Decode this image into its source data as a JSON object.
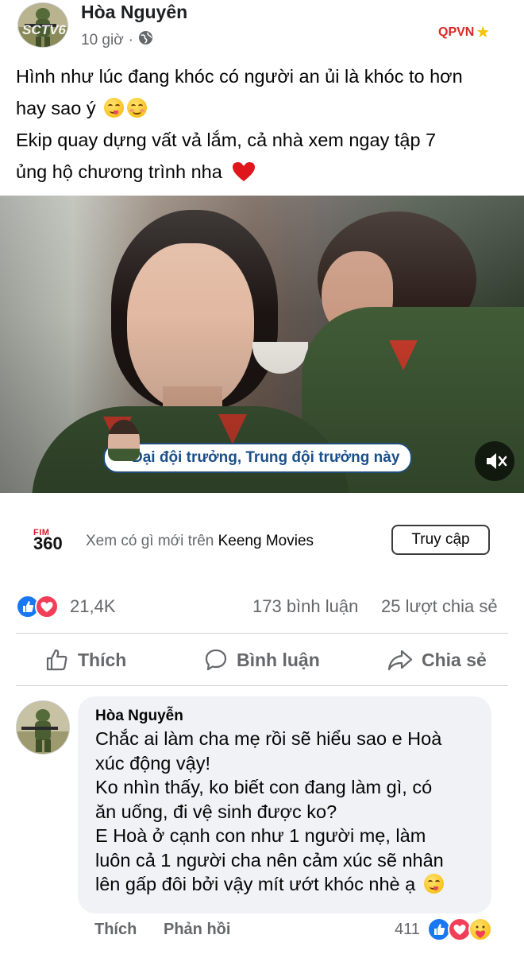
{
  "post": {
    "author": "Hòa Nguyên",
    "time": "10 giờ",
    "separator": "·",
    "privacy_icon": "globe-icon",
    "text_lines": [
      "Hình như lúc đang khóc có người an ủi là khóc to hơn",
      "hay sao ý",
      "Ekip quay dựng vất vả lắm, cả nhà xem ngay tập 7",
      "ủng hộ chương trình nha"
    ]
  },
  "video": {
    "channel_logo_left": "SCTV6",
    "channel_logo_right": "QPVN",
    "caption": "Đại đội trưởng, Trung đội trưởng này",
    "mute_icon": "speaker-muted-icon"
  },
  "ad": {
    "logo_top": "FIM",
    "logo_bottom": "360",
    "text": "Xem có gì mới trên",
    "brand": "Keeng Movies",
    "cta": "Truy cập"
  },
  "stats": {
    "reactions": "21,4K",
    "comments": "173 bình luận",
    "shares": "25 lượt chia sẻ"
  },
  "actions": {
    "like": "Thích",
    "comment": "Bình luận",
    "share": "Chia sẻ"
  },
  "comment": {
    "author": "Hòa Nguyễn",
    "lines": [
      "Chắc ai làm cha mẹ rồi sẽ hiểu sao e Hoà",
      "xúc động vậy!",
      "Ko nhìn thấy, ko biết con đang làm gì, có",
      "ăn uống, đi vệ sinh được ko?",
      "E Hoà ở cạnh con như 1 người mẹ, làm",
      "luôn cả 1 người cha nên cảm xúc sẽ nhân",
      "lên gấp đôi bởi vậy mít ướt khóc nhè ạ"
    ],
    "like_label": "Thích",
    "reply_label": "Phản hồi",
    "reaction_count": "411"
  },
  "colors": {
    "facebook_blue": "#1877f2",
    "love_red": "#f33e58",
    "secondary_text": "#65676b",
    "bubble_bg": "#f0f2f5"
  }
}
